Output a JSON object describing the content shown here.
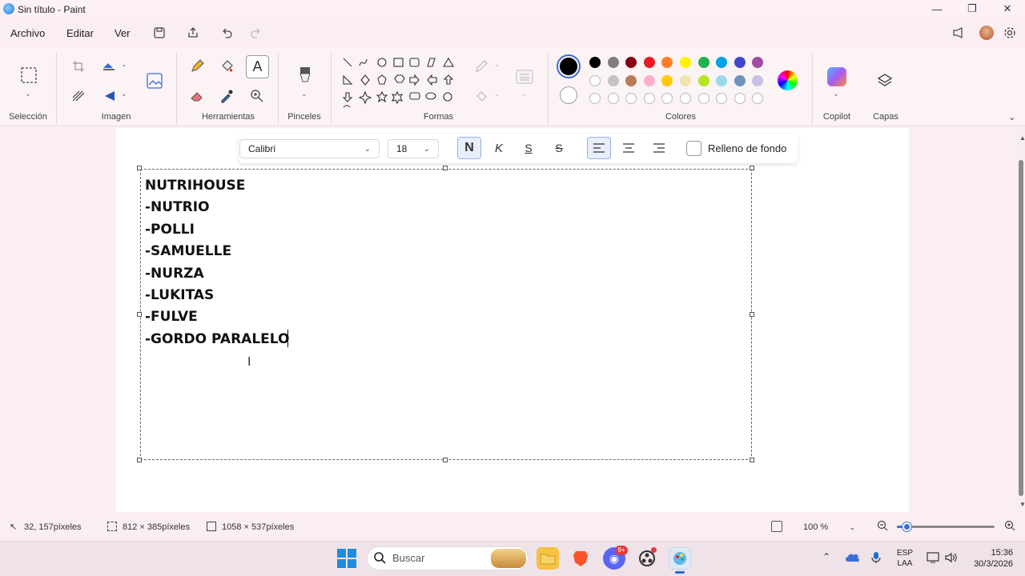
{
  "window": {
    "title": "Sin título - Paint",
    "minimize": "—",
    "restore": "❐",
    "close": "✕"
  },
  "menu": {
    "items": [
      "Archivo",
      "Editar",
      "Ver"
    ]
  },
  "ribbon": {
    "groups": [
      "Selección",
      "Imagen",
      "Herramientas",
      "Pinceles",
      "Formas",
      "Colores",
      "Copilot",
      "Capas"
    ]
  },
  "colors": {
    "primary": "#000000",
    "secondary": "#ffffff",
    "row1": [
      "#000000",
      "#7f7f7f",
      "#880015",
      "#ed1c24",
      "#ff7f27",
      "#fff200",
      "#22b14c",
      "#00a2e8",
      "#3f48cc",
      "#a349a4"
    ],
    "row2": [
      "#ffffff",
      "#c3c3c3",
      "#b97a57",
      "#ffaec9",
      "#ffc90e",
      "#efe4b0",
      "#b5e61d",
      "#99d9ea",
      "#7092be",
      "#c8bfe7"
    ],
    "row3_empty": 10
  },
  "text_toolbar": {
    "font": "Calibri",
    "size": "18",
    "bold": "N",
    "italic": "K",
    "underline": "S",
    "strikethrough": "S",
    "background_fill": "Relleno de fondo"
  },
  "canvas_text": [
    "NUTRIHOUSE",
    "-NUTRIO",
    "-POLLI",
    "-SAMUELLE",
    "-NURZA",
    "-LUKITAS",
    "-FULVE",
    "-GORDO PARALELO"
  ],
  "status": {
    "cursor": "32, 157píxeles",
    "selection": "812 × 385píxeles",
    "canvas_size": "1058 × 537píxeles",
    "zoom": "100 %",
    "zoom_level": 0.1
  },
  "taskbar": {
    "search_placeholder": "Buscar",
    "lang1": "ESP",
    "lang2": "LAA",
    "time": "15:36",
    "date": "30/3/2026",
    "badge": "9+"
  }
}
